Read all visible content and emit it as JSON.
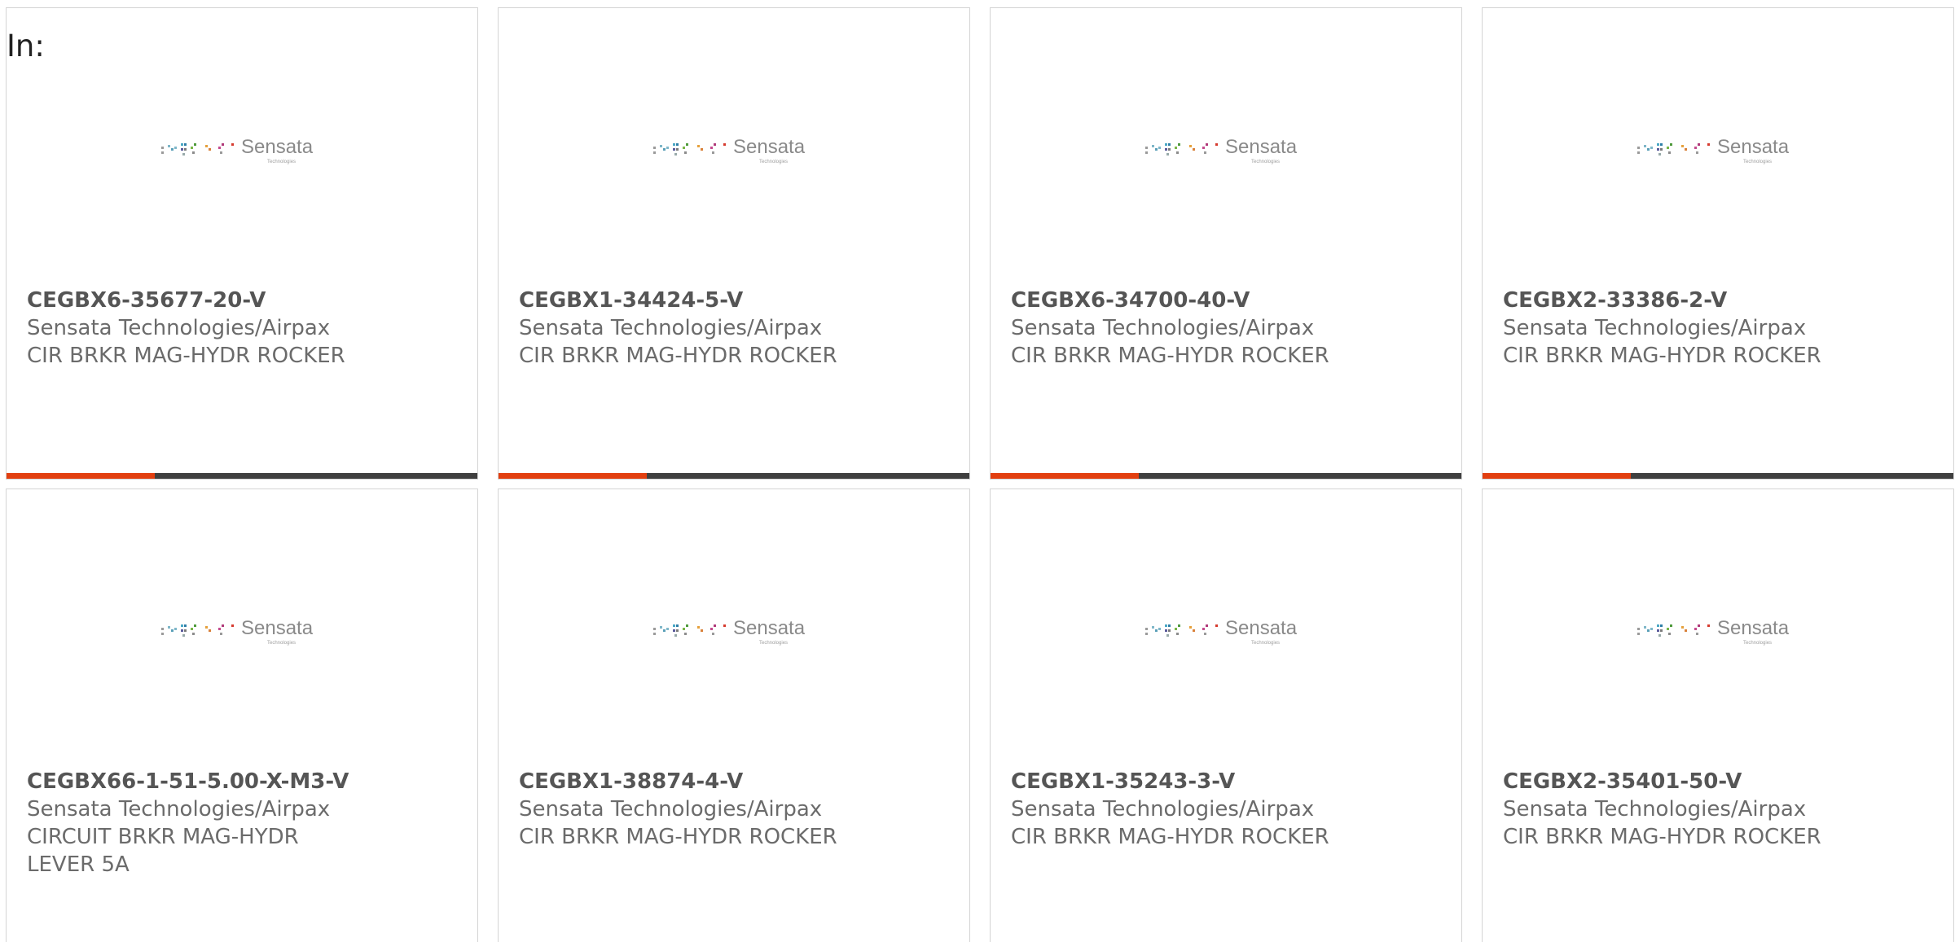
{
  "header": {
    "label": "In:"
  },
  "colors": {
    "accent": "#e23f10",
    "bar": "#3f3f3f",
    "card_border": "#d4d4d4",
    "part_number": "#555555",
    "text": "#6b6b6b"
  },
  "logo": {
    "brand": "Sensata",
    "sub": "Technologies",
    "icon": "sensata-dot-matrix-logo"
  },
  "products": [
    {
      "part_number": "CEGBX6-35677-20-V",
      "manufacturer": "Sensata Technologies/Airpax",
      "description": "CIR BRKR MAG-HYDR ROCKER"
    },
    {
      "part_number": "CEGBX1-34424-5-V",
      "manufacturer": "Sensata Technologies/Airpax",
      "description": "CIR BRKR MAG-HYDR ROCKER"
    },
    {
      "part_number": "CEGBX6-34700-40-V",
      "manufacturer": "Sensata Technologies/Airpax",
      "description": "CIR BRKR MAG-HYDR ROCKER"
    },
    {
      "part_number": "CEGBX2-33386-2-V",
      "manufacturer": "Sensata Technologies/Airpax",
      "description": "CIR BRKR MAG-HYDR ROCKER"
    },
    {
      "part_number": "CEGBX66-1-51-5.00-X-M3-V",
      "manufacturer": "Sensata Technologies/Airpax",
      "description": "CIRCUIT BRKR MAG-HYDR LEVER 5A"
    },
    {
      "part_number": "CEGBX1-38874-4-V",
      "manufacturer": "Sensata Technologies/Airpax",
      "description": "CIR BRKR MAG-HYDR ROCKER"
    },
    {
      "part_number": "CEGBX1-35243-3-V",
      "manufacturer": "Sensata Technologies/Airpax",
      "description": "CIR BRKR MAG-HYDR ROCKER"
    },
    {
      "part_number": "CEGBX2-35401-50-V",
      "manufacturer": "Sensata Technologies/Airpax",
      "description": "CIR BRKR MAG-HYDR ROCKER"
    }
  ]
}
